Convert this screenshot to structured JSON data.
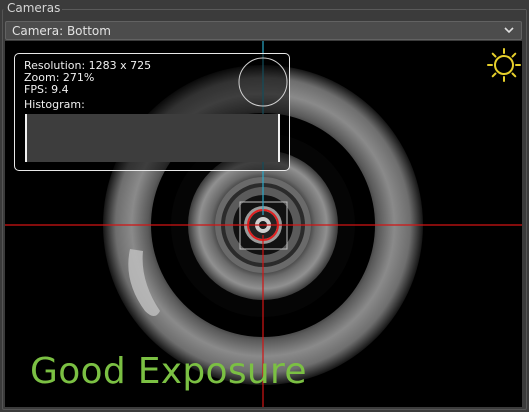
{
  "panel": {
    "title": "Cameras"
  },
  "camera_select": {
    "value": "Camera: Bottom"
  },
  "overlay": {
    "resolution": "Resolution: 1283 x 725",
    "zoom": "Zoom: 271%",
    "fps": "FPS: 9.4",
    "histogram_label": "Histogram:"
  },
  "exposure_text": "Good Exposure",
  "colors": {
    "crosshair_horizontal": "#d21414",
    "crosshair_vertical_top": "#2aa8c8",
    "crosshair_vertical_bottom": "#d21414",
    "sun_icon": "#e6cf2b",
    "exposure_text": "#7bc043",
    "target_ring": "#e02020"
  }
}
